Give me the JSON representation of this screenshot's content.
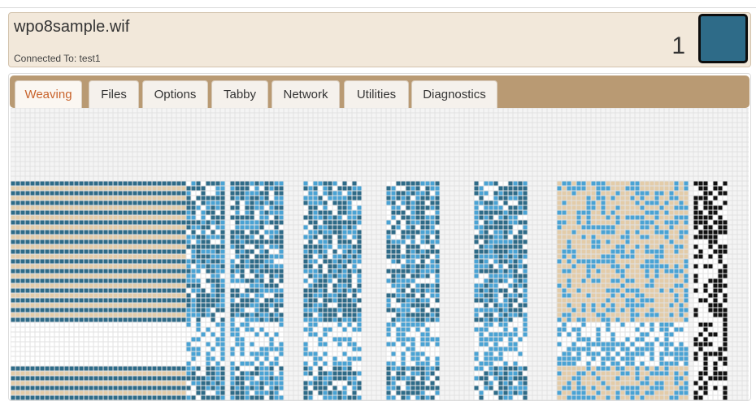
{
  "header": {
    "file_name": "wpo8sample.wif",
    "connection_status": "Connected To: test1",
    "pick_number": "1",
    "current_color": "#2e6b88"
  },
  "tabs": [
    {
      "label": "Weaving",
      "active": true
    },
    {
      "label": "Files",
      "active": false
    },
    {
      "label": "Options",
      "active": false
    },
    {
      "label": "Tabby",
      "active": false
    },
    {
      "label": "Network",
      "active": false
    },
    {
      "label": "Utilities",
      "active": false
    },
    {
      "label": "Diagnostics",
      "active": false
    }
  ],
  "colors": {
    "blue_light": "#4aa3d4",
    "blue_dark": "#2e6b88",
    "tan": "#e3cca9",
    "black": "#111111",
    "grid_line": "#e2e2e2",
    "empty_cell": "#f4f4f4"
  }
}
